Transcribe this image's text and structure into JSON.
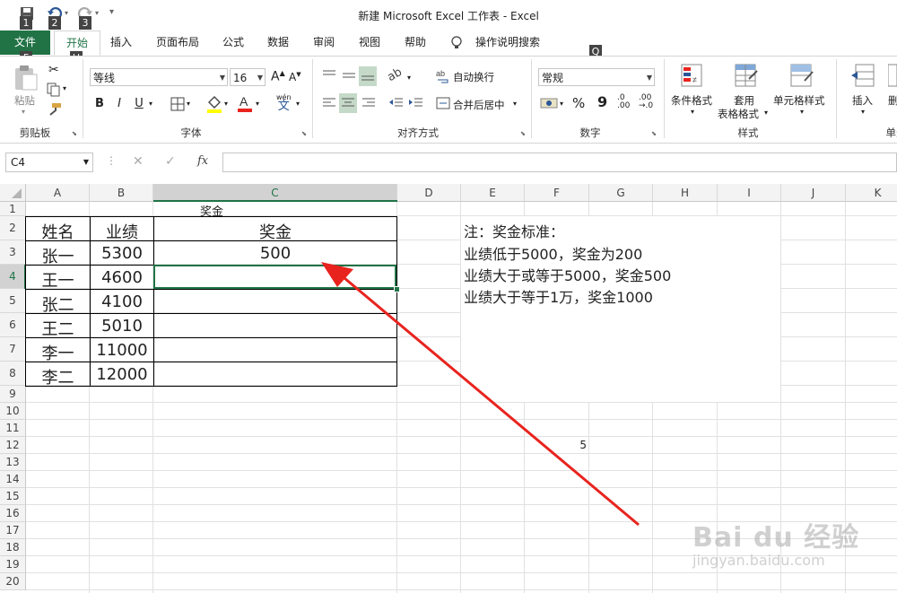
{
  "window": {
    "title": "新建 Microsoft Excel 工作表  -  Excel"
  },
  "quick_access": {
    "keytips": [
      "1",
      "2",
      "3"
    ]
  },
  "tabs": [
    {
      "label": "文件",
      "keytip": "F"
    },
    {
      "label": "开始",
      "keytip": "H"
    },
    {
      "label": "插入"
    },
    {
      "label": "页面布局"
    },
    {
      "label": "公式"
    },
    {
      "label": "数据"
    },
    {
      "label": "审阅"
    },
    {
      "label": "视图"
    },
    {
      "label": "帮助"
    }
  ],
  "tell_me": {
    "label": "操作说明搜索",
    "keytip": "Q"
  },
  "ribbon": {
    "clipboard": {
      "paste": "粘贴",
      "group": "剪贴板"
    },
    "font": {
      "name": "等线",
      "size": "16",
      "group": "字体",
      "bold": "B",
      "italic": "I",
      "underline": "U",
      "grow": "A",
      "shrink": "A",
      "wen": "wén",
      "wen_char": "文"
    },
    "alignment": {
      "wrap": "自动换行",
      "merge": "合并后居中",
      "group": "对齐方式"
    },
    "number": {
      "format": "常规",
      "percent": "%",
      "comma": "9",
      "group": "数字",
      "inc": ".0",
      "inc2": ".00",
      "dec": ".00",
      "dec2": "→.0"
    },
    "styles": {
      "conditional": "条件格式",
      "table_l1": "套用",
      "table_l2": "表格格式",
      "cell_styles": "单元格样式",
      "group": "样式"
    },
    "cells": {
      "insert": "插入",
      "delete": "删",
      "group": "单元"
    }
  },
  "formula_bar": {
    "name_box": "C4",
    "fx": "fx",
    "formula": ""
  },
  "columns": [
    "A",
    "B",
    "C",
    "D",
    "E",
    "F",
    "G",
    "H",
    "I",
    "J",
    "K"
  ],
  "rows": [
    "1",
    "2",
    "3",
    "4",
    "5",
    "6",
    "7",
    "8",
    "9",
    "10",
    "11",
    "12",
    "13",
    "14",
    "15",
    "16",
    "17",
    "18",
    "19",
    "20"
  ],
  "sheet": {
    "c1": "奖金",
    "table_header": [
      "姓名",
      "业绩",
      "奖金"
    ],
    "table_rows": [
      [
        "张一",
        "5300",
        "500"
      ],
      [
        "王一",
        "4600",
        ""
      ],
      [
        "张二",
        "4100",
        ""
      ],
      [
        "王二",
        "5010",
        ""
      ],
      [
        "李一",
        "11000",
        ""
      ],
      [
        "李二",
        "12000",
        ""
      ]
    ],
    "note_lines": [
      "注：奖金标准：",
      "业绩低于5000，奖金为200",
      "业绩大于或等于5000，奖金500",
      "业绩大于等于1万，奖金1000"
    ],
    "f12": "5"
  },
  "watermark": {
    "brand": "Bai du 经验",
    "url": "jingyan.baidu.com"
  },
  "colors": {
    "excel_green": "#217346",
    "arrow_red": "#e8231e",
    "selection": "#217346"
  }
}
